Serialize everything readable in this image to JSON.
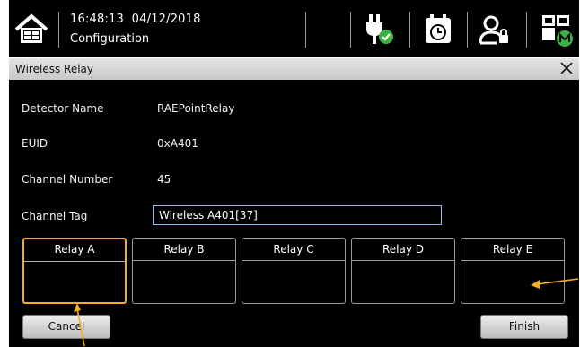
{
  "status_bar": {
    "time": "16:48:13",
    "date": "04/12/2018",
    "screen_title": "Configuration",
    "icons": [
      "home-icon",
      "power-ok-icon",
      "calendar-clock-icon",
      "user-lock-icon",
      "dashboard-m-icon"
    ]
  },
  "dialog": {
    "title": "Wireless Relay",
    "close_label": "×",
    "fields": {
      "detector_name": {
        "label": "Detector Name",
        "value": "RAEPointRelay"
      },
      "euid": {
        "label": "EUID",
        "value": "0xA401"
      },
      "channel_number": {
        "label": "Channel Number",
        "value": "45"
      },
      "channel_tag": {
        "label": "Channel Tag",
        "value": "Wireless A401[37]"
      }
    },
    "relays": [
      {
        "label": "Relay A",
        "selected": true
      },
      {
        "label": "Relay B",
        "selected": false
      },
      {
        "label": "Relay C",
        "selected": false
      },
      {
        "label": "Relay D",
        "selected": false
      },
      {
        "label": "Relay E",
        "selected": false
      }
    ],
    "buttons": {
      "cancel": "Cancel",
      "finish": "Finish"
    }
  },
  "colors": {
    "selection": "#f5b020",
    "annotation_arrow": "#f5b020",
    "input_border": "#8fb8e6",
    "ok_green": "#3cb043"
  }
}
